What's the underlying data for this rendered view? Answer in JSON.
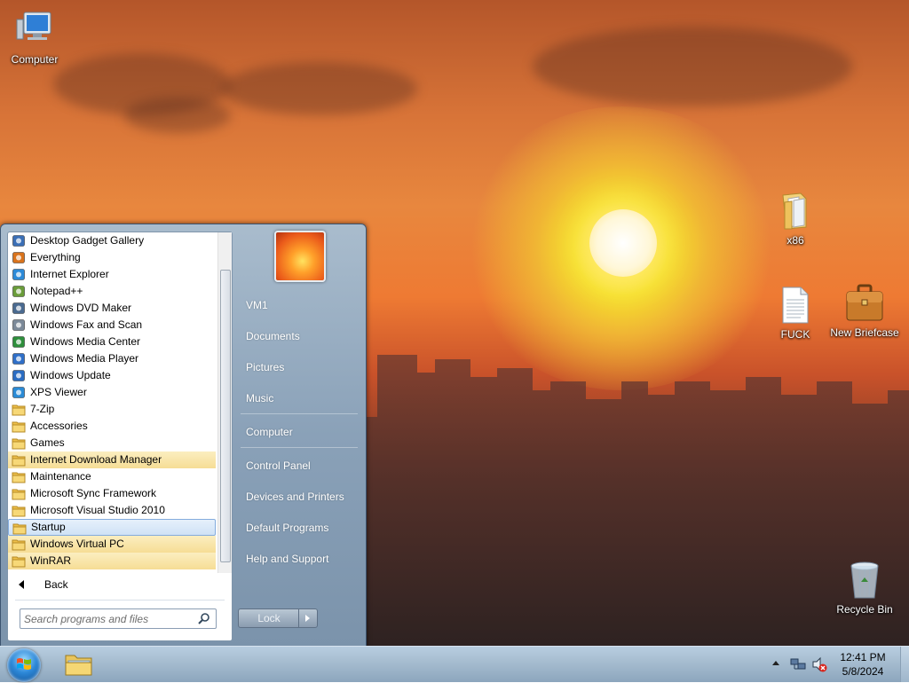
{
  "desktop": {
    "icons": [
      {
        "label": "Computer"
      },
      {
        "label": "x86"
      },
      {
        "label": "FUCK"
      },
      {
        "label": "New Briefcase"
      },
      {
        "label": "Recycle Bin"
      }
    ]
  },
  "start_menu": {
    "programs": [
      {
        "label": "Desktop Gadget Gallery",
        "icon": "gadget-icon"
      },
      {
        "label": "Everything",
        "icon": "magnifier-icon"
      },
      {
        "label": "Internet Explorer",
        "icon": "ie-icon"
      },
      {
        "label": "Notepad++",
        "icon": "notepad-icon"
      },
      {
        "label": "Windows DVD Maker",
        "icon": "dvd-icon"
      },
      {
        "label": "Windows Fax and Scan",
        "icon": "fax-icon"
      },
      {
        "label": "Windows Media Center",
        "icon": "media-center-icon"
      },
      {
        "label": "Windows Media Player",
        "icon": "media-player-icon"
      },
      {
        "label": "Windows Update",
        "icon": "update-icon"
      },
      {
        "label": "XPS Viewer",
        "icon": "xps-icon"
      },
      {
        "label": "7-Zip",
        "icon": "folder-icon"
      },
      {
        "label": "Accessories",
        "icon": "folder-icon"
      },
      {
        "label": "Games",
        "icon": "folder-icon"
      },
      {
        "label": "Internet Download Manager",
        "icon": "folder-icon"
      },
      {
        "label": "Maintenance",
        "icon": "folder-icon"
      },
      {
        "label": "Microsoft Sync Framework",
        "icon": "folder-icon"
      },
      {
        "label": "Microsoft Visual Studio 2010",
        "icon": "folder-icon"
      },
      {
        "label": "Startup",
        "icon": "folder-icon"
      },
      {
        "label": "Windows Virtual PC",
        "icon": "folder-icon"
      },
      {
        "label": "WinRAR",
        "icon": "folder-icon"
      }
    ],
    "back_label": "Back",
    "search_placeholder": "Search programs and files",
    "right_items": [
      {
        "label": "VM1"
      },
      {
        "label": "Documents"
      },
      {
        "label": "Pictures"
      },
      {
        "label": "Music"
      },
      {
        "label": "Computer"
      },
      {
        "label": "Control Panel"
      },
      {
        "label": "Devices and Printers"
      },
      {
        "label": "Default Programs"
      },
      {
        "label": "Help and Support"
      }
    ],
    "lock_label": "Lock"
  },
  "taskbar": {
    "time": "12:41 PM",
    "date": "5/8/2024"
  }
}
